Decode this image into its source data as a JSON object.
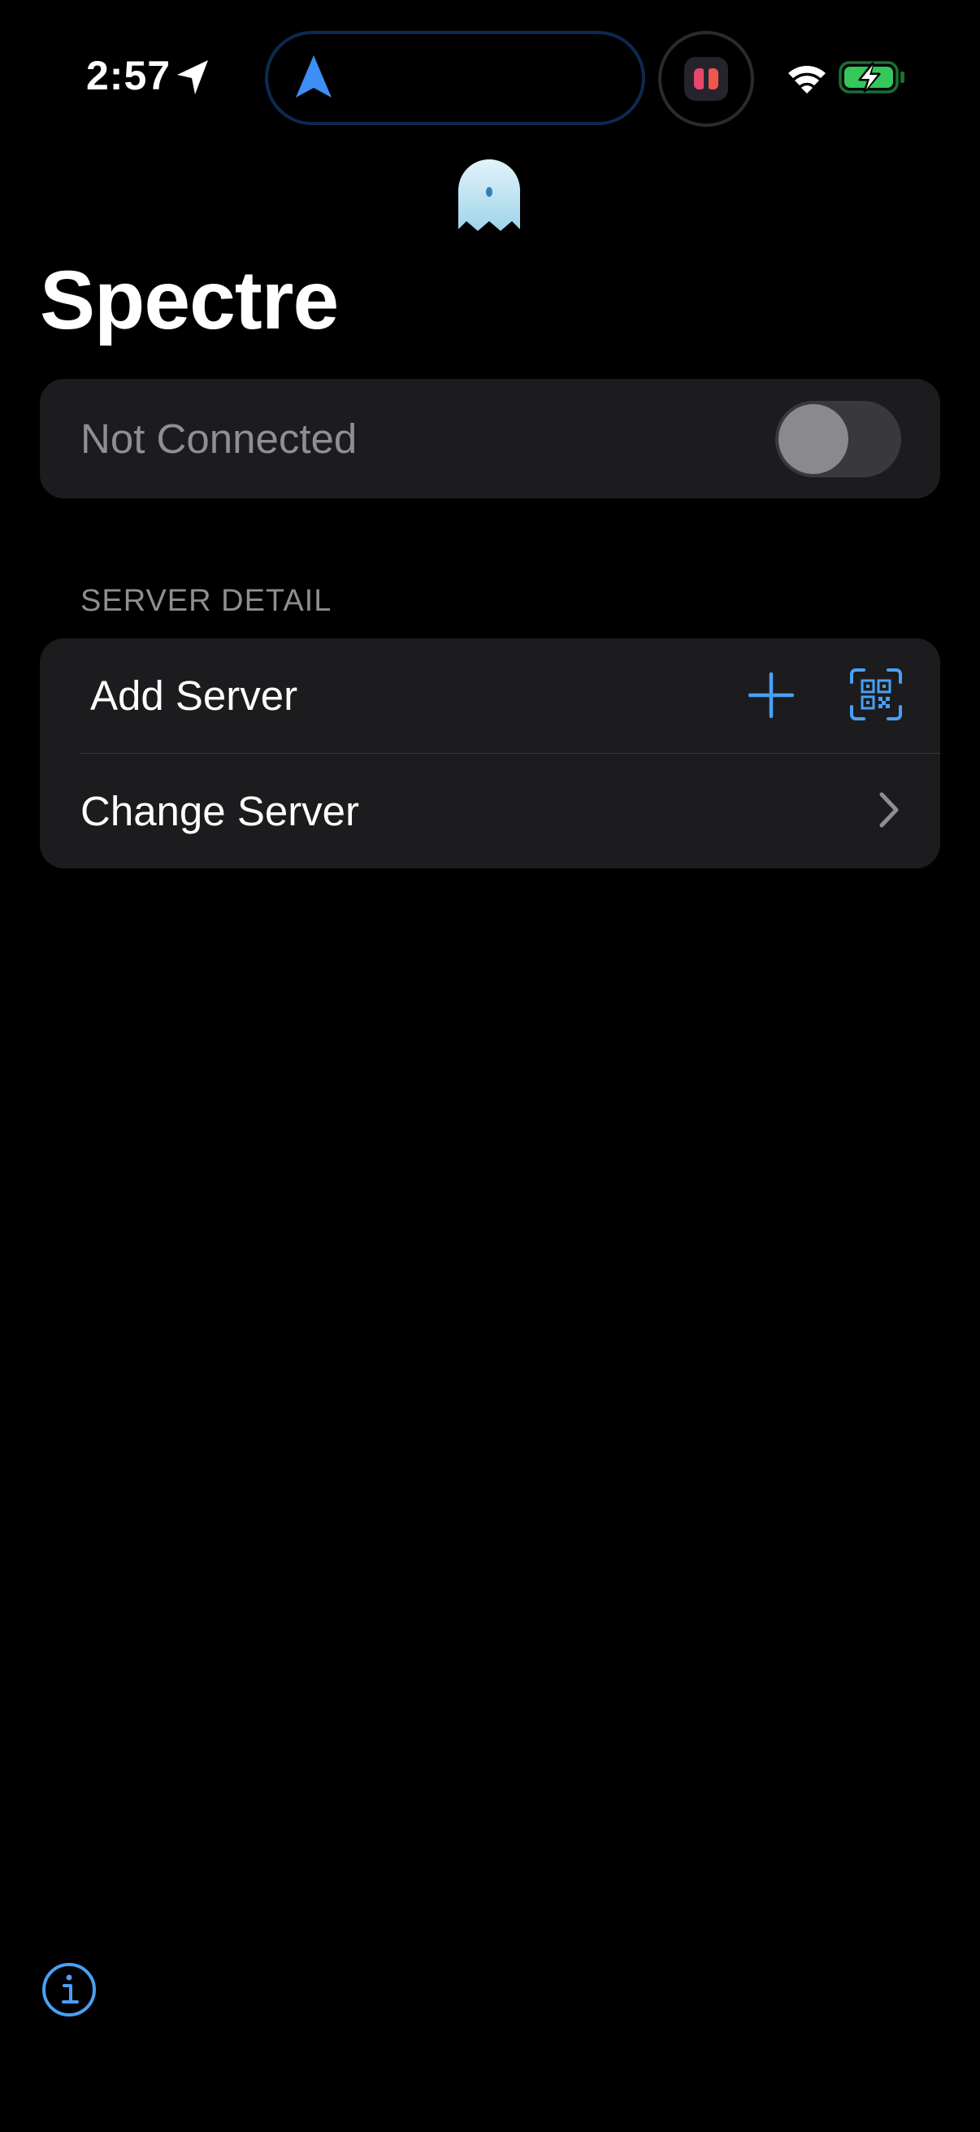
{
  "status_bar": {
    "time": "2:57",
    "icons": [
      "location-arrow-icon",
      "navigation-arrow-icon",
      "app-live-activity-icon",
      "wifi-icon",
      "battery-charging-icon"
    ]
  },
  "header": {
    "logo_icon": "ghost-icon",
    "title": "Spectre"
  },
  "connection": {
    "status_label": "Not Connected",
    "toggle_on": false
  },
  "server_section": {
    "header": "SERVER DETAIL",
    "add_label": "Add Server",
    "add_icon": "plus-icon",
    "scan_icon": "qr-scan-icon",
    "change_label": "Change Server",
    "change_icon": "chevron-right-icon"
  },
  "footer": {
    "info_icon": "info-icon"
  },
  "colors": {
    "background": "#000000",
    "card": "#1c1c1e",
    "accent": "#4a9ff5",
    "secondary_text": "#8e8e93",
    "battery_green": "#34c759"
  }
}
